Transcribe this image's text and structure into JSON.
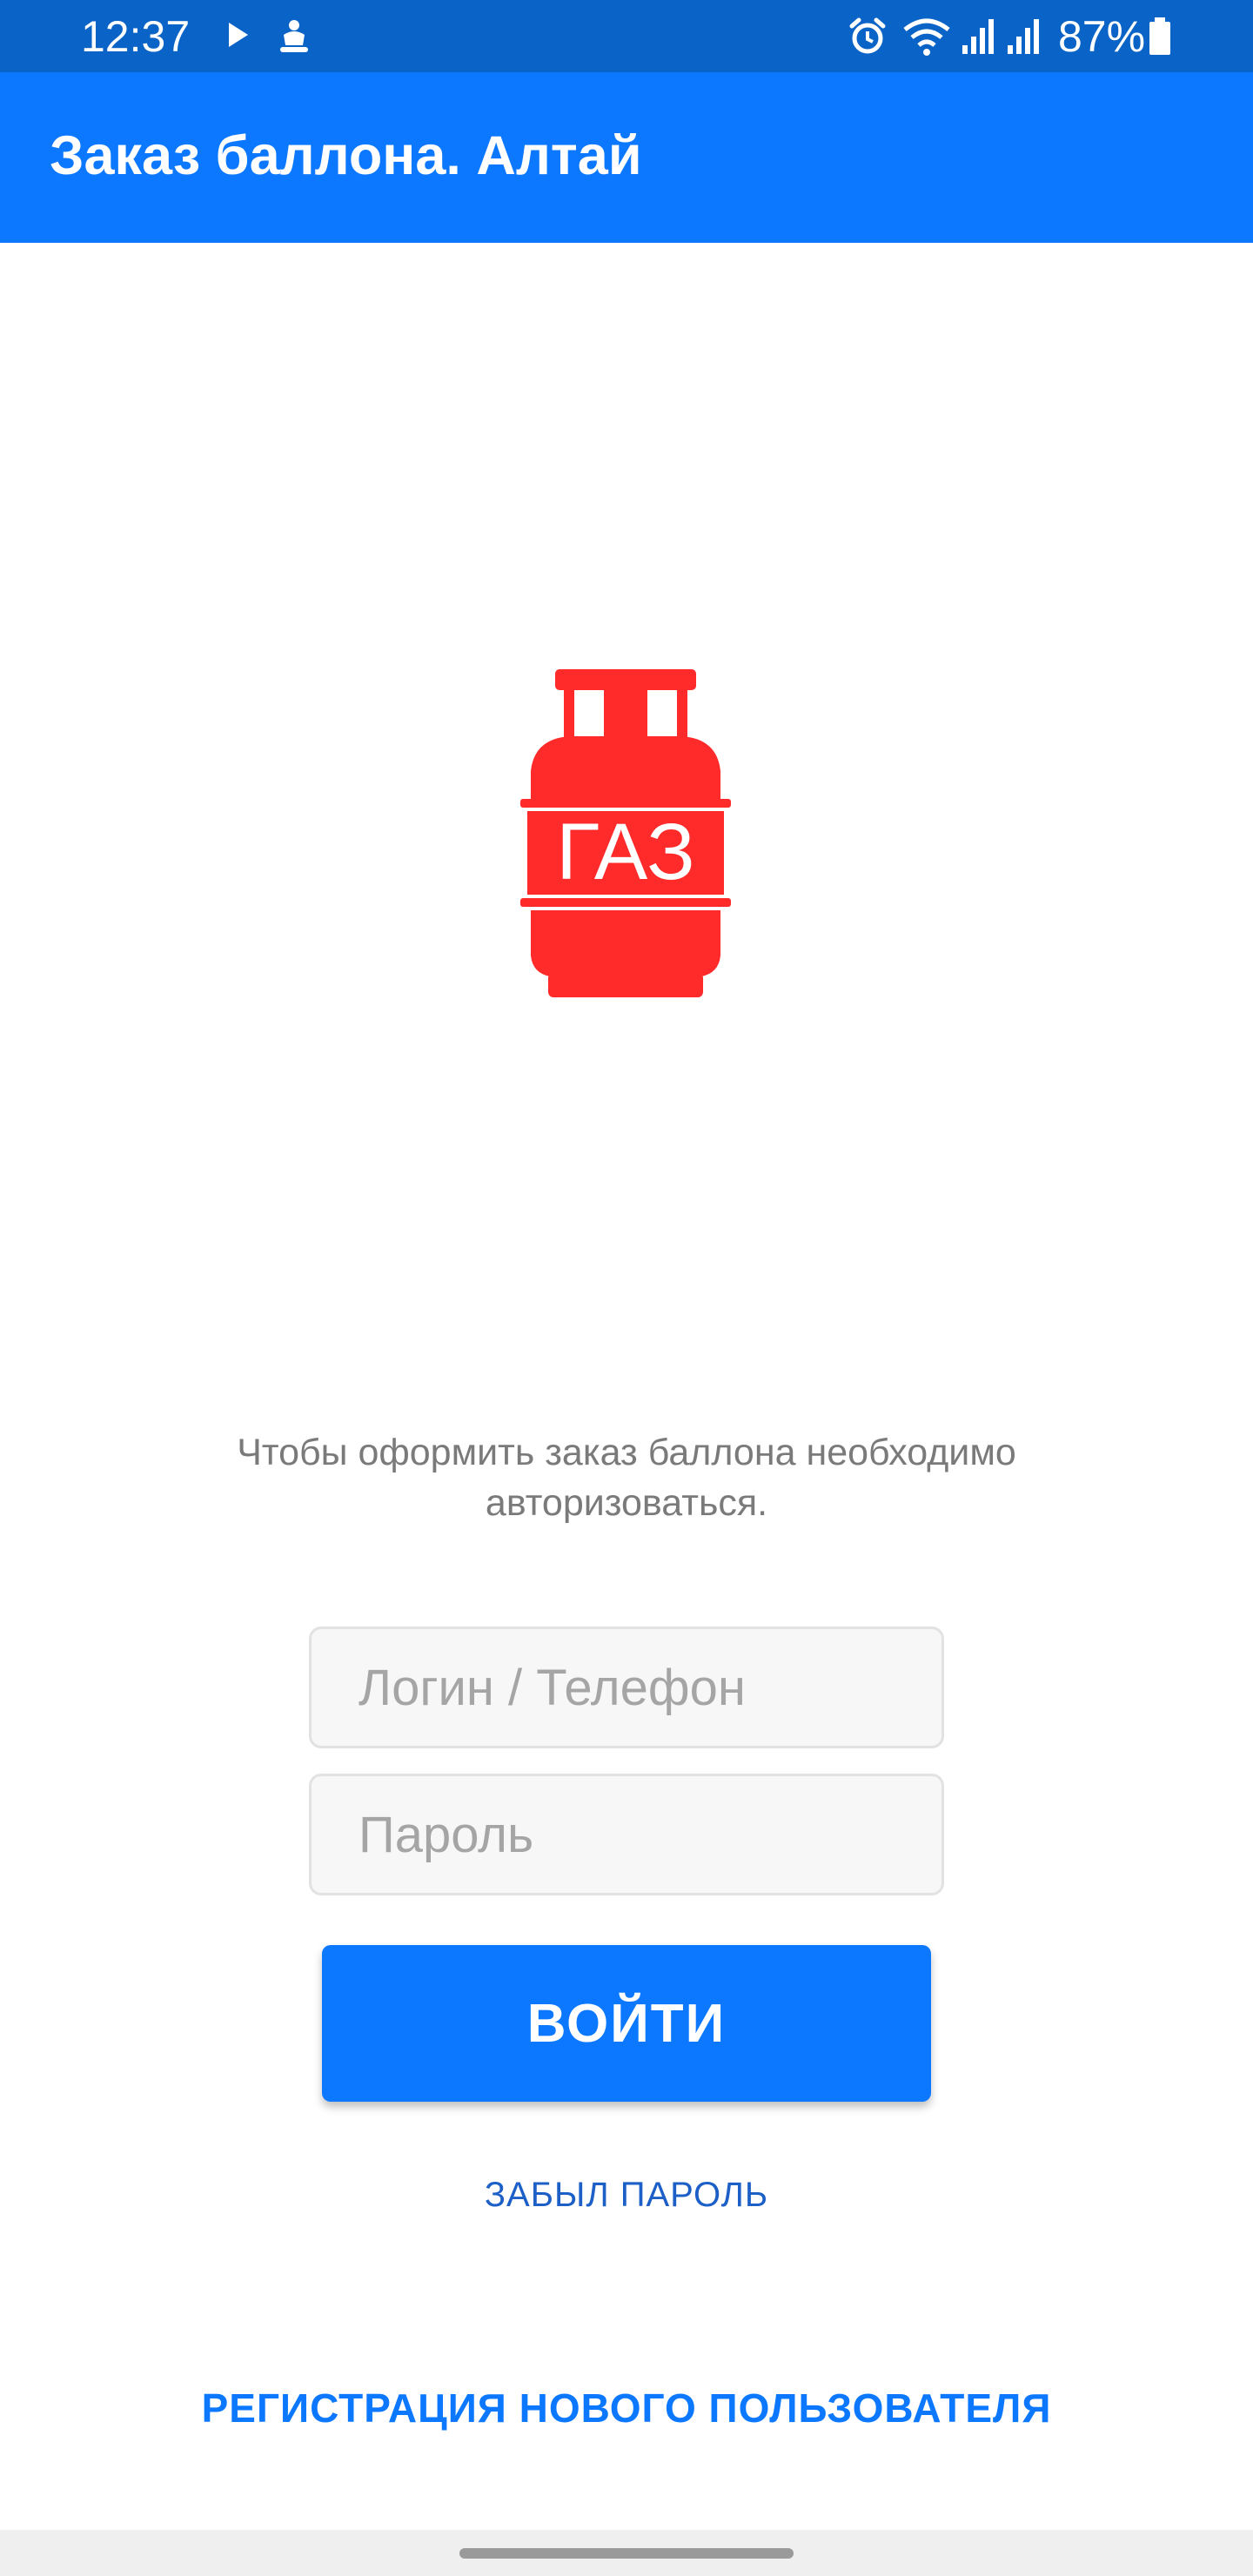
{
  "status_bar": {
    "time": "12:37",
    "battery_text": "87%",
    "left_icons": [
      "play-icon",
      "notification-app-icon"
    ],
    "right_icons": [
      "alarm-icon",
      "wifi-icon",
      "signal-icon",
      "signal-icon",
      "battery-icon"
    ],
    "background_color": "#0a63c7"
  },
  "app_bar": {
    "title": "Заказ баллона. Алтай",
    "background_color": "#0b78ff"
  },
  "logo": {
    "icon": "gas-cylinder-icon",
    "label": "ГАЗ",
    "color": "#ff2a2a"
  },
  "auth": {
    "message": "Чтобы оформить заказ баллона необходимо авторизоваться.",
    "login_placeholder": "Логин / Телефон",
    "password_placeholder": "Пароль",
    "login_button": "ВОЙТИ",
    "forgot_password": "ЗАБЫЛ ПАРОЛЬ",
    "register": "РЕГИСТРАЦИЯ НОВОГО ПОЛЬЗОВАТЕЛЯ"
  },
  "colors": {
    "accent": "#0b78ff",
    "link": "#1b5fc7",
    "muted_text": "#7a7a7a"
  }
}
